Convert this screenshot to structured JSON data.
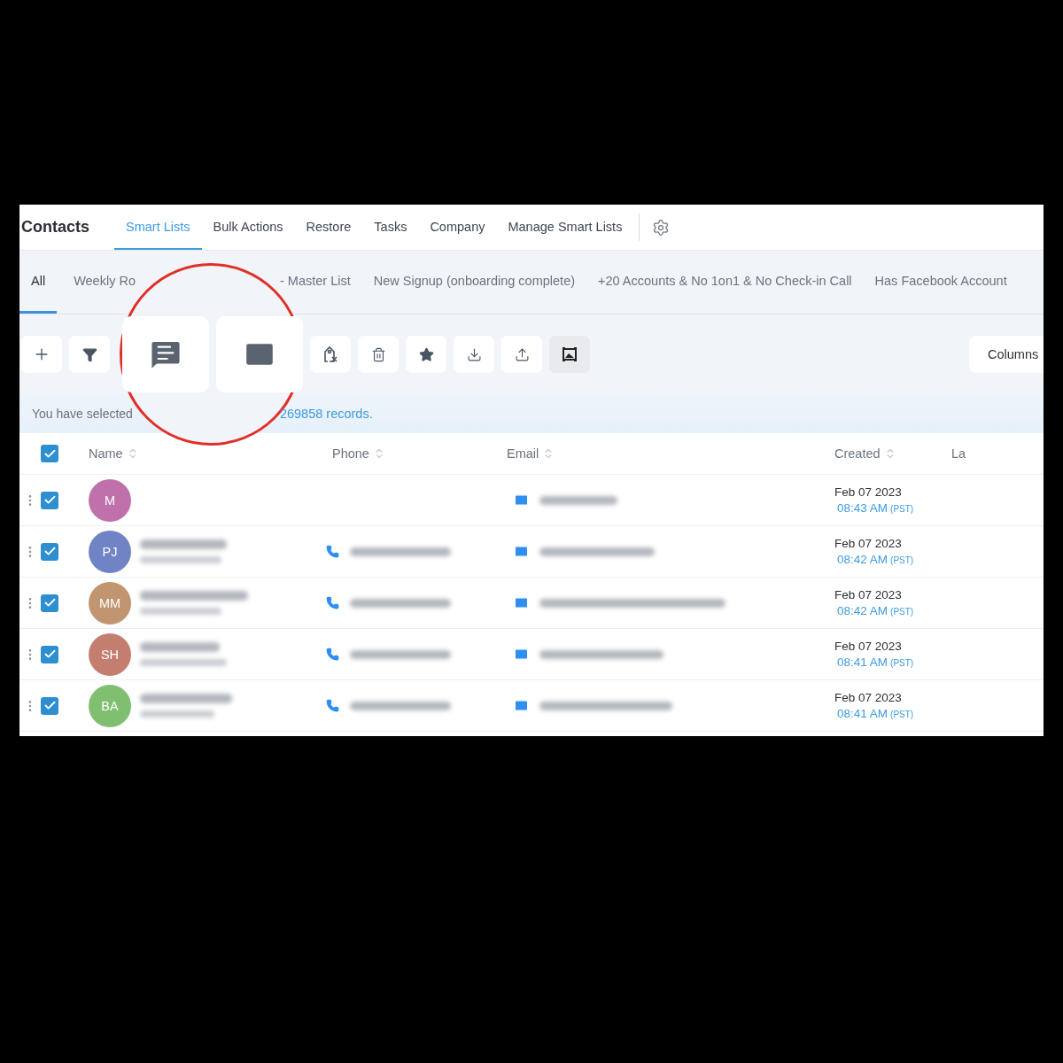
{
  "nav": {
    "title": "Contacts",
    "tabs": [
      {
        "label": "Smart Lists",
        "selected": true
      },
      {
        "label": "Bulk Actions",
        "selected": false
      },
      {
        "label": "Restore",
        "selected": false
      },
      {
        "label": "Tasks",
        "selected": false
      },
      {
        "label": "Company",
        "selected": false
      },
      {
        "label": "Manage Smart Lists",
        "selected": false
      }
    ]
  },
  "list_tabs": [
    {
      "label": "All",
      "selected": true
    },
    {
      "label": "Weekly Ro",
      "selected": false
    },
    {
      "label": "- Master List",
      "selected": false
    },
    {
      "label": "New Signup (onboarding complete)",
      "selected": false
    },
    {
      "label": "+20 Accounts & No 1on1 & No Check-in Call",
      "selected": false
    },
    {
      "label": "Has Facebook Account",
      "selected": false
    }
  ],
  "toolbar": {
    "columns_button": "Columns"
  },
  "selection": {
    "prefix": "You have selected",
    "count": "269858 records."
  },
  "table": {
    "select_all": true,
    "columns": [
      "Name",
      "Phone",
      "Email",
      "Created",
      "La"
    ],
    "rows": [
      {
        "initials": "M",
        "color": "#c070aa",
        "checked": true,
        "has_phone": false,
        "date": "Feb 07 2023",
        "time": "08:43 AM",
        "zone": "(PST)"
      },
      {
        "initials": "PJ",
        "color": "#7083c4",
        "checked": true,
        "has_phone": true,
        "date": "Feb 07 2023",
        "time": "08:42 AM",
        "zone": "(PST)"
      },
      {
        "initials": "MM",
        "color": "#c09570",
        "checked": true,
        "has_phone": true,
        "date": "Feb 07 2023",
        "time": "08:42 AM",
        "zone": "(PST)"
      },
      {
        "initials": "SH",
        "color": "#c47e70",
        "checked": true,
        "has_phone": true,
        "date": "Feb 07 2023",
        "time": "08:41 AM",
        "zone": "(PST)"
      },
      {
        "initials": "BA",
        "color": "#7fbf6f",
        "checked": true,
        "has_phone": true,
        "date": "Feb 07 2023",
        "time": "08:41 AM",
        "zone": "(PST)"
      }
    ]
  }
}
